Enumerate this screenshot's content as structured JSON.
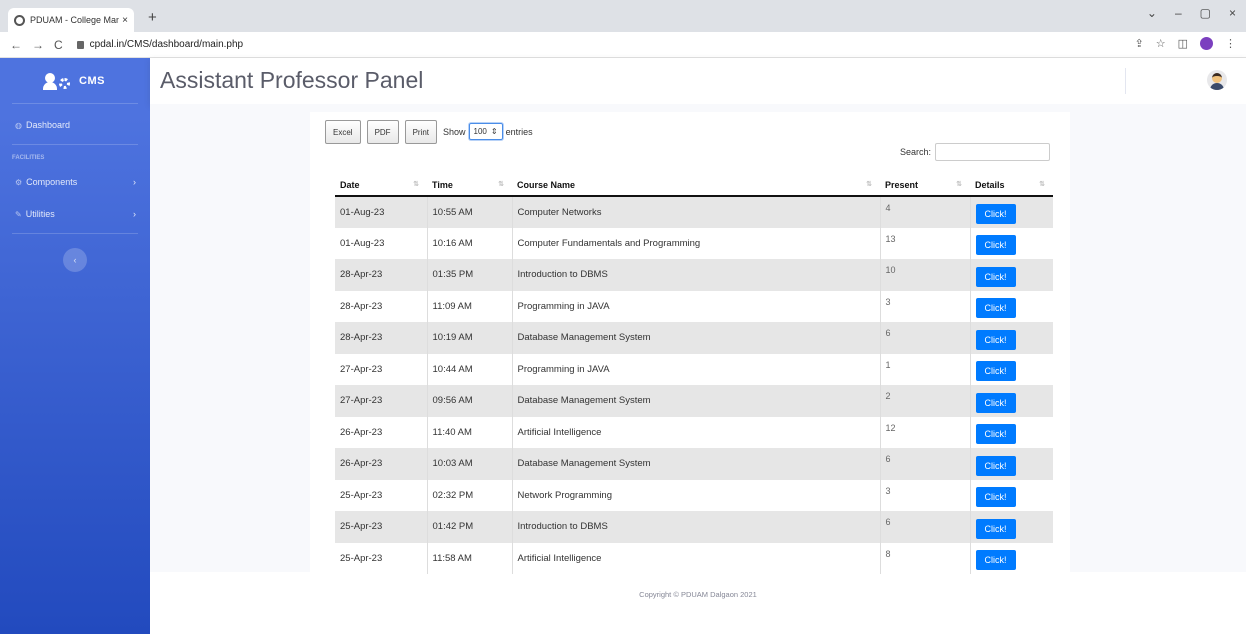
{
  "browser": {
    "tab_title": "PDUAM - College Management",
    "tab_close": "×",
    "new_tab": "+",
    "url": "cpdal.in/CMS/dashboard/main.php",
    "window_controls": [
      "⌄",
      "–",
      "▢",
      "×"
    ]
  },
  "sidebar": {
    "brand": "CMS",
    "dashboard_label": "Dashboard",
    "heading": "FACILITIES",
    "components_label": "Components",
    "utilities_label": "Utilities",
    "toggle_icon": "‹"
  },
  "topbar": {
    "title": "Assistant Professor Panel"
  },
  "toolbar": {
    "excel": "Excel",
    "pdf": "PDF",
    "print": "Print",
    "show": "Show",
    "entries_value": "100",
    "entries": "entries",
    "search_label": "Search:"
  },
  "table": {
    "headers": [
      "Date",
      "Time",
      "Course Name",
      "Present",
      "Details"
    ],
    "button_label": "Click!",
    "rows": [
      {
        "date": "01-Aug-23",
        "time": "10:55 AM",
        "course": "Computer Networks",
        "present": "4"
      },
      {
        "date": "01-Aug-23",
        "time": "10:16 AM",
        "course": "Computer Fundamentals and Programming",
        "present": "13"
      },
      {
        "date": "28-Apr-23",
        "time": "01:35 PM",
        "course": "Introduction to DBMS",
        "present": "10"
      },
      {
        "date": "28-Apr-23",
        "time": "11:09 AM",
        "course": "Programming in JAVA",
        "present": "3"
      },
      {
        "date": "28-Apr-23",
        "time": "10:19 AM",
        "course": "Database Management System",
        "present": "6"
      },
      {
        "date": "27-Apr-23",
        "time": "10:44 AM",
        "course": "Programming in JAVA",
        "present": "1"
      },
      {
        "date": "27-Apr-23",
        "time": "09:56 AM",
        "course": "Database Management System",
        "present": "2"
      },
      {
        "date": "26-Apr-23",
        "time": "11:40 AM",
        "course": "Artificial Intelligence",
        "present": "12"
      },
      {
        "date": "26-Apr-23",
        "time": "10:03 AM",
        "course": "Database Management System",
        "present": "6"
      },
      {
        "date": "25-Apr-23",
        "time": "02:32 PM",
        "course": "Network Programming",
        "present": "3"
      },
      {
        "date": "25-Apr-23",
        "time": "01:42 PM",
        "course": "Introduction to DBMS",
        "present": "6"
      },
      {
        "date": "25-Apr-23",
        "time": "11:58 AM",
        "course": "Artificial Intelligence",
        "present": "8"
      }
    ]
  },
  "footer": {
    "copyright": "Copyright © PDUAM Dalgaon 2021"
  },
  "colors": {
    "sidebar_top": "#4e73df",
    "sidebar_bottom": "#224abe",
    "button_blue": "#007bff"
  }
}
